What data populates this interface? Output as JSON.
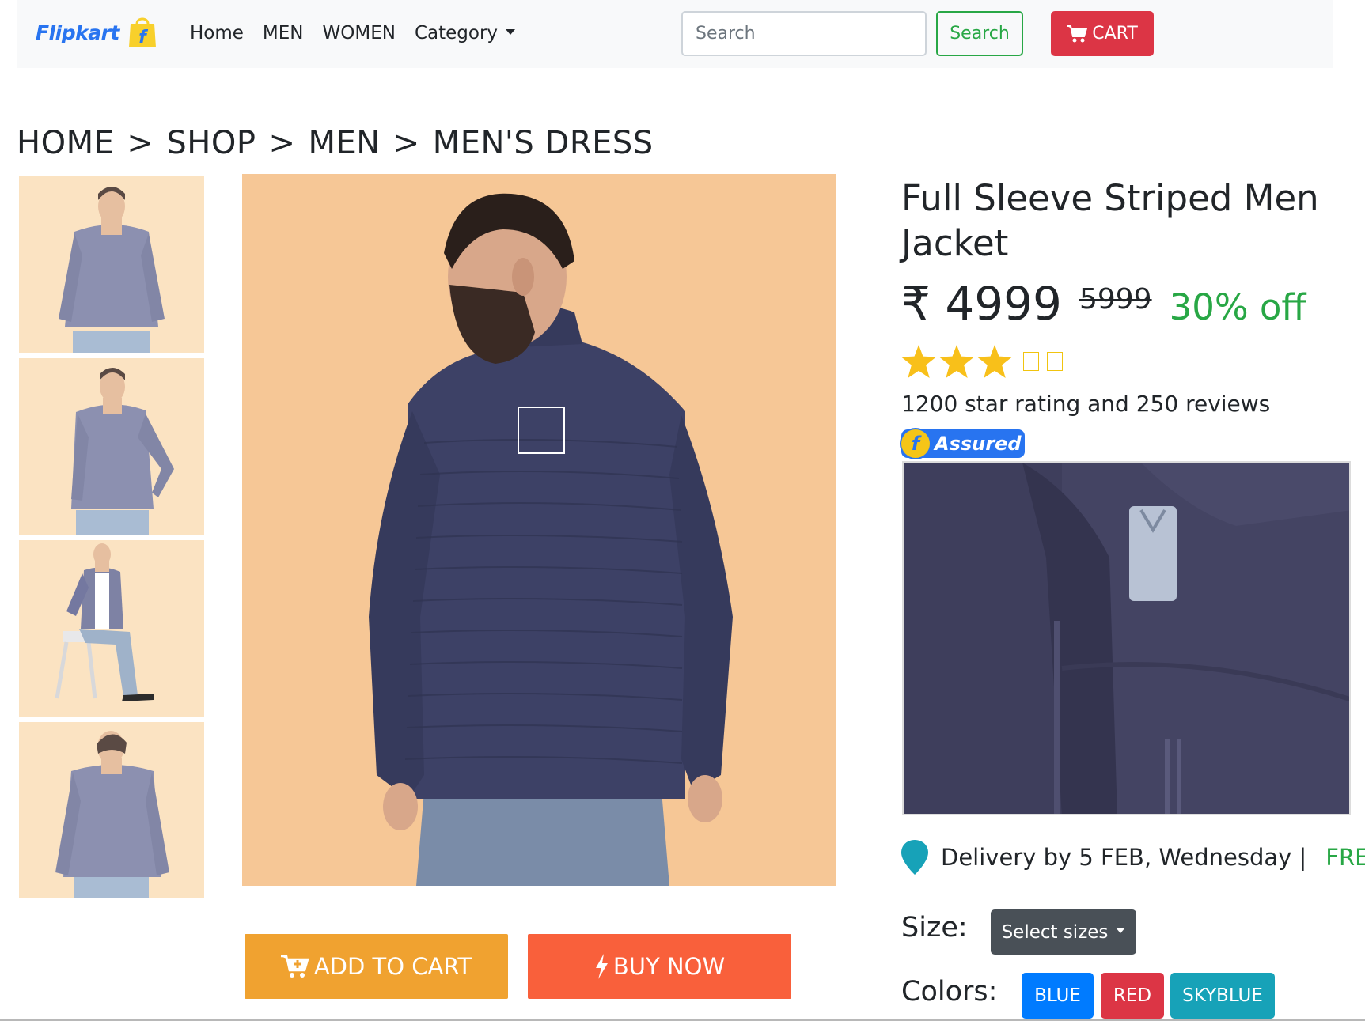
{
  "navbar": {
    "brand": "Flipkart",
    "links": [
      "Home",
      "MEN",
      "WOMEN",
      "Category"
    ],
    "search_placeholder": "Search",
    "search_button": "Search",
    "cart_button": "CART"
  },
  "breadcrumb": [
    "HOME",
    "SHOP",
    "MEN",
    "MEN'S DRESS"
  ],
  "breadcrumb_separator": ">",
  "product": {
    "title": "Full Sleeve Striped Men Jacket",
    "currency_symbol": "₹",
    "price": "4999",
    "original_price": "5999",
    "discount": "30% off",
    "rating_stars_filled": 3,
    "rating_stars_total": 5,
    "rating_text": "1200 star rating and 250 reviews",
    "assured_label": "Assured",
    "delivery_text": "Delivery by 5 FEB, Wednesday |",
    "delivery_fee": "FREE",
    "size_label": "Size:",
    "size_select": "Select sizes",
    "colors_label": "Colors:",
    "colors": [
      "BLUE",
      "RED",
      "SKYBLUE"
    ]
  },
  "actions": {
    "add_to_cart": "ADD TO CART",
    "buy_now": "BUY NOW"
  },
  "theme": {
    "brand_blue": "#2874f0",
    "success_green": "#28a745",
    "danger_red": "#dc3545",
    "add_cart_orange": "#f0a230",
    "buy_now_orange": "#f9603b",
    "star_yellow": "#f8c01a",
    "jacket_navy": "#3d4166"
  }
}
